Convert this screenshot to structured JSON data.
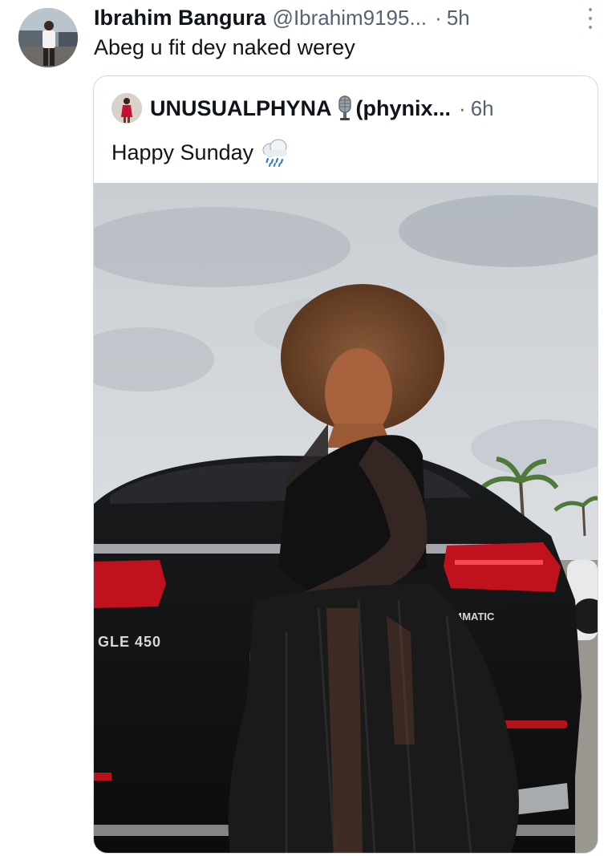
{
  "tweet": {
    "display_name": "Ibrahim Bangura",
    "handle": "@Ibrahim9195...",
    "separator": "·",
    "time": "5h",
    "text": "Abeg u fit dey naked werey"
  },
  "quoted_tweet": {
    "display_name": "UNUSUALPHYNA",
    "handle": "(phynix...",
    "separator": "·",
    "time": "6h",
    "text": "Happy Sunday",
    "media": {
      "plate_text": "GLE 450",
      "badge_text": "4MATIC"
    }
  },
  "icons": {
    "more": "more-vertical-icon",
    "microphone": "studio-microphone-emoji",
    "rain_cloud": "cloud-with-rain-emoji"
  }
}
